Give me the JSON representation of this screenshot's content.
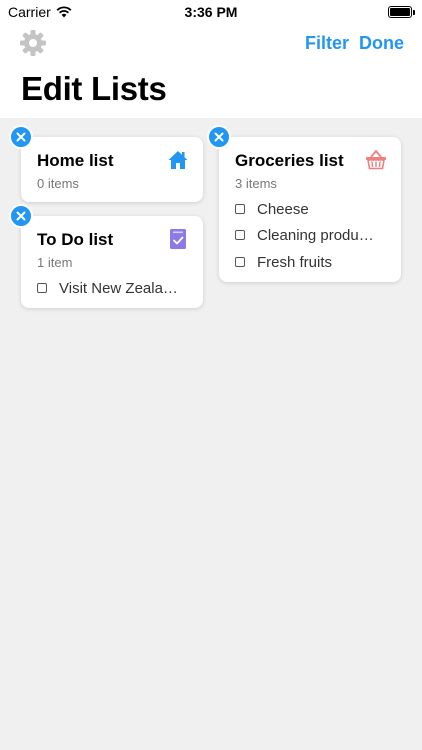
{
  "status_bar": {
    "carrier": "Carrier",
    "time": "3:36 PM",
    "icons": [
      "wifi-icon",
      "battery-icon"
    ]
  },
  "header": {
    "settings_icon": "gear-icon",
    "filter_label": "Filter",
    "done_label": "Done",
    "title": "Edit Lists"
  },
  "colors": {
    "accent": "#2196f3",
    "home_icon": "#2196f3",
    "groceries_icon": "#f08080",
    "todo_icon": "#8c7ae6"
  },
  "lists": [
    {
      "title": "Home list",
      "count": "0 items",
      "icon": "house-icon",
      "items": []
    },
    {
      "title": "Groceries list",
      "count": "3 items",
      "icon": "basket-icon",
      "items": [
        "Cheese",
        "Cleaning produ…",
        "Fresh fruits"
      ]
    },
    {
      "title": "To Do list",
      "count": "1 item",
      "icon": "checklist-icon",
      "items": [
        "Visit New Zeala…"
      ]
    }
  ]
}
